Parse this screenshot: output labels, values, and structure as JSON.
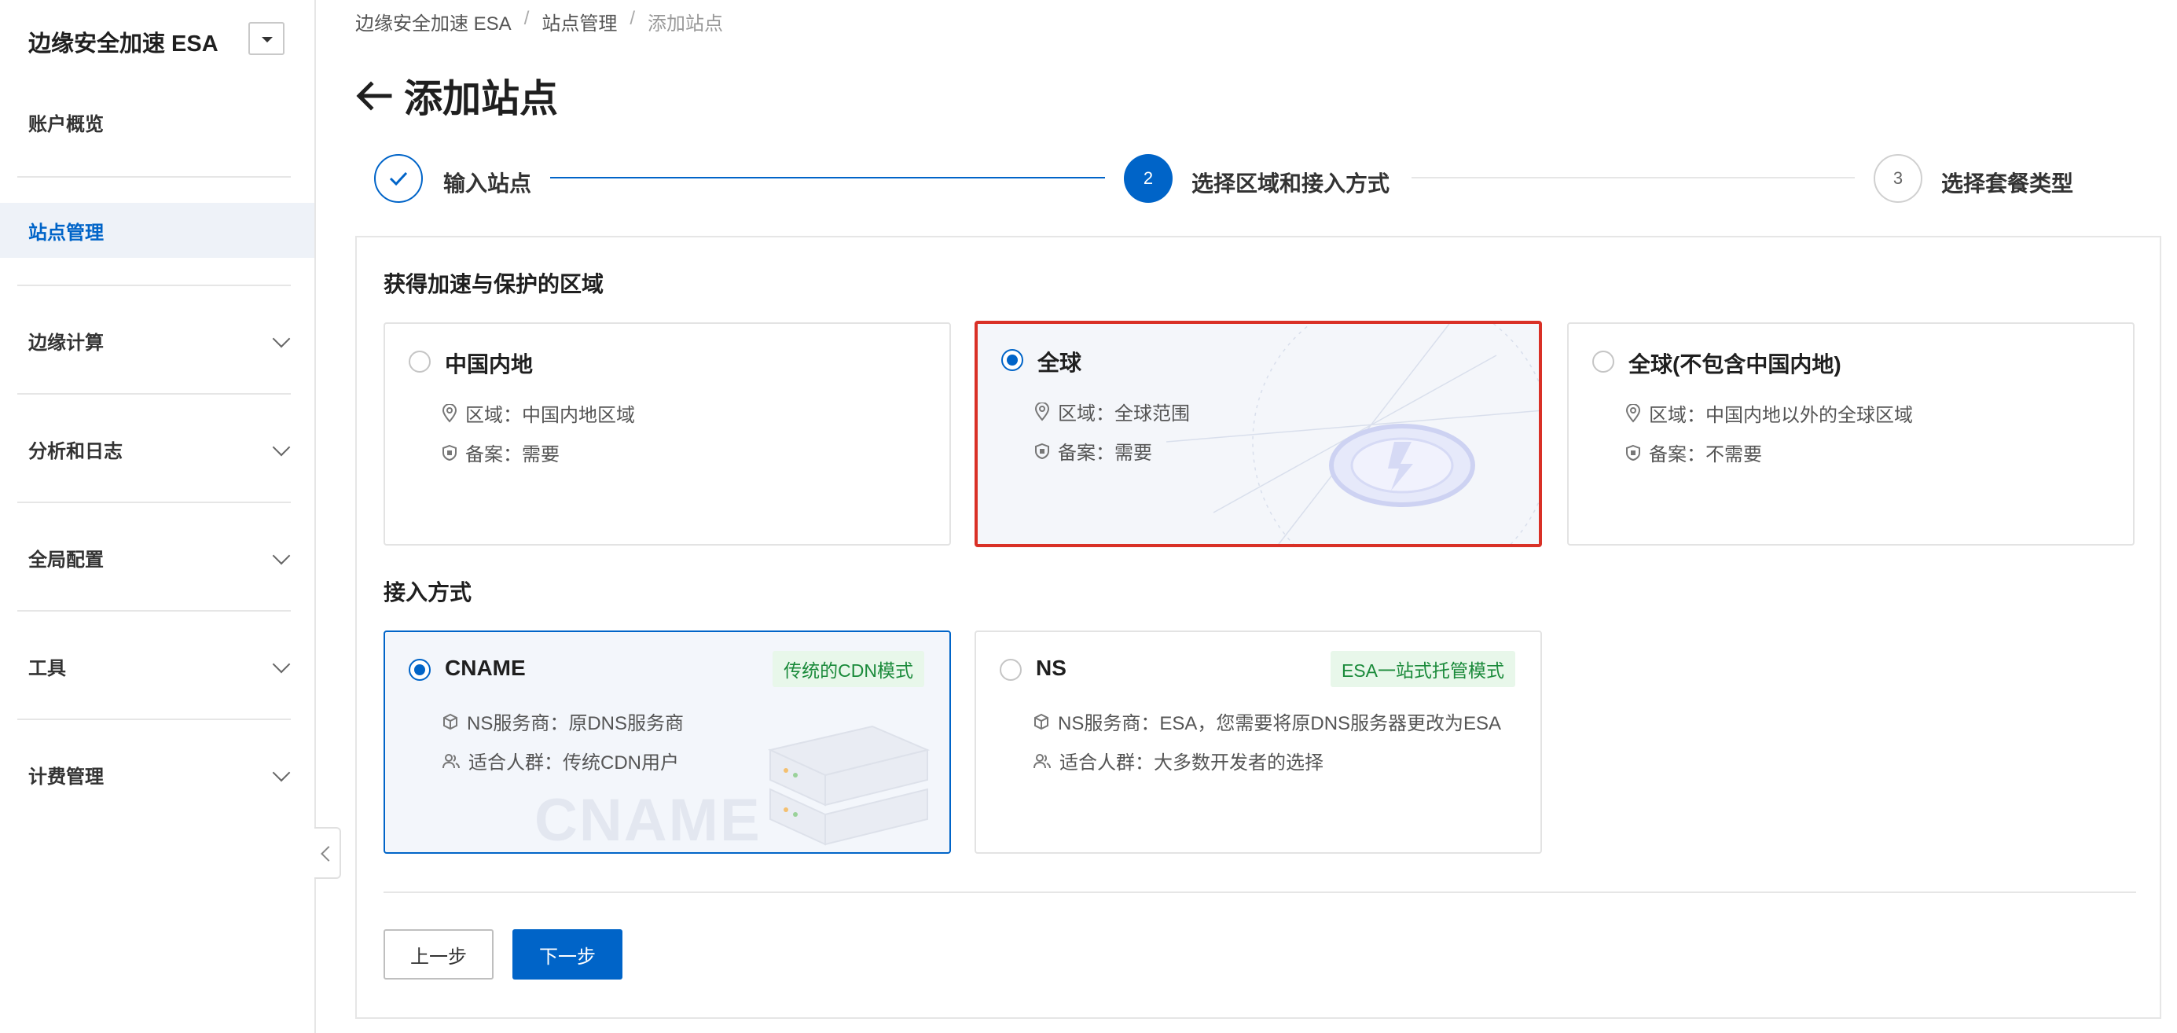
{
  "sidebar": {
    "title": "边缘安全加速 ESA",
    "items": [
      {
        "label": "账户概览"
      },
      {
        "label": "站点管理"
      },
      {
        "label": "边缘计算"
      },
      {
        "label": "分析和日志"
      },
      {
        "label": "全局配置"
      },
      {
        "label": "工具"
      },
      {
        "label": "计费管理"
      }
    ]
  },
  "breadcrumb": [
    "边缘安全加速 ESA",
    "站点管理",
    "添加站点"
  ],
  "breadcrumb_sep": "/",
  "page": {
    "title": "添加站点"
  },
  "steps": [
    {
      "label": "输入站点",
      "state": "done"
    },
    {
      "label": "选择区域和接入方式",
      "number": "2",
      "state": "current"
    },
    {
      "label": "选择套餐类型",
      "number": "3",
      "state": "todo"
    }
  ],
  "region": {
    "title": "获得加速与保护的区域",
    "options": [
      {
        "title": "中国内地",
        "area": "区域：中国内地区域",
        "filing": "备案：需要",
        "selected": false
      },
      {
        "title": "全球",
        "area": "区域：全球范围",
        "filing": "备案：需要",
        "selected": true
      },
      {
        "title": "全球(不包含中国内地)",
        "area": "区域：中国内地以外的全球区域",
        "filing": "备案：不需要",
        "selected": false
      }
    ]
  },
  "access": {
    "title": "接入方式",
    "options": [
      {
        "title": "CNAME",
        "tag": "传统的CDN模式",
        "ns": "NS服务商：原DNS服务商",
        "users": "适合人群：传统CDN用户",
        "watermark": "CNAME",
        "selected": true
      },
      {
        "title": "NS",
        "tag": "ESA一站式托管模式",
        "ns": "NS服务商：ESA，您需要将原DNS服务器更改为ESA",
        "users": "适合人群：大多数开发者的选择",
        "selected": false
      }
    ]
  },
  "buttons": {
    "prev": "上一步",
    "next": "下一步"
  },
  "colors": {
    "primary": "#0064c8",
    "highlight": "#d93026",
    "tag_text": "#1a8a3a",
    "tag_bg": "#e8f7ea"
  }
}
